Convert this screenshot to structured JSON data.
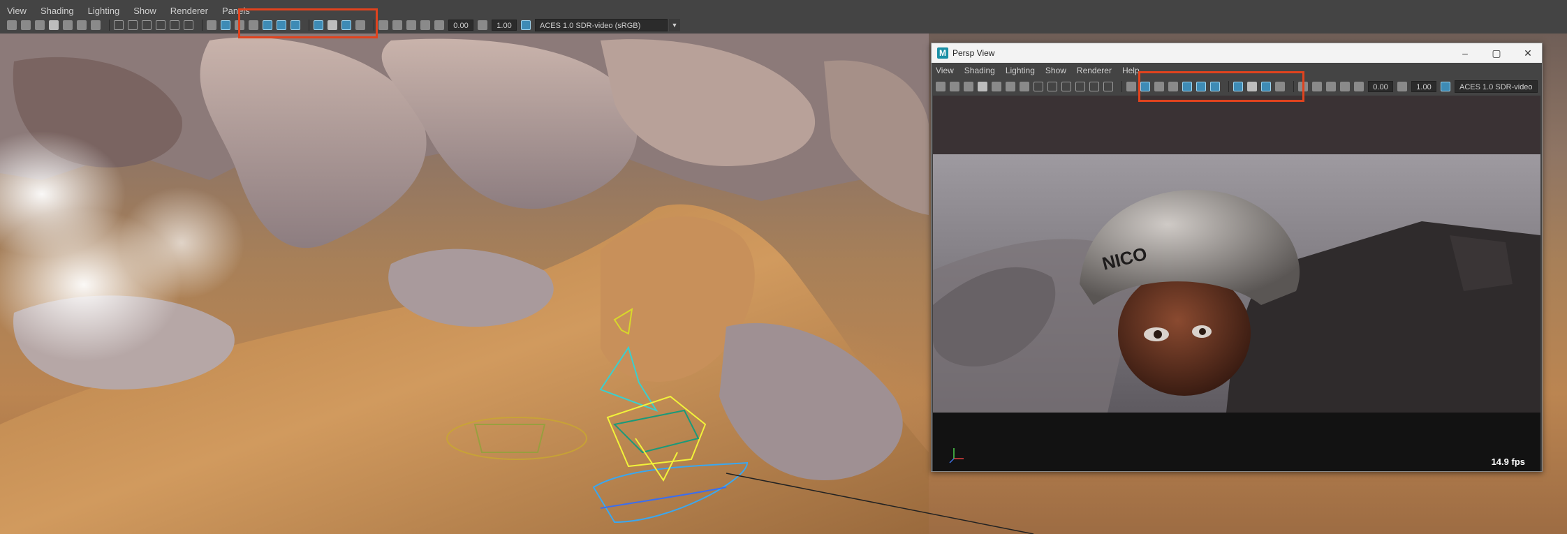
{
  "main": {
    "menus": [
      "View",
      "Shading",
      "Lighting",
      "Show",
      "Renderer",
      "Panels"
    ],
    "toolbar": {
      "exposure_value": "0.00",
      "gamma_value": "1.00",
      "color_space": "ACES 1.0 SDR-video (sRGB)"
    }
  },
  "persp_window": {
    "title": "Persp View",
    "app_icon": "M",
    "menus": [
      "View",
      "Shading",
      "Lighting",
      "Show",
      "Renderer",
      "Help"
    ],
    "toolbar": {
      "exposure_value": "0.00",
      "gamma_value": "1.00",
      "color_space": "ACES 1.0 SDR-video"
    },
    "helmet_text": "NICO",
    "fps": "14.9 fps"
  },
  "colors": {
    "ui_bg": "#444444",
    "highlight": "#e0431e",
    "icon_active": "#3e8bb5"
  },
  "icons": {
    "minimize": "window-minimize-icon",
    "maximize": "window-maximize-icon",
    "close": "window-close-icon",
    "axis": "view-axis-icon"
  }
}
